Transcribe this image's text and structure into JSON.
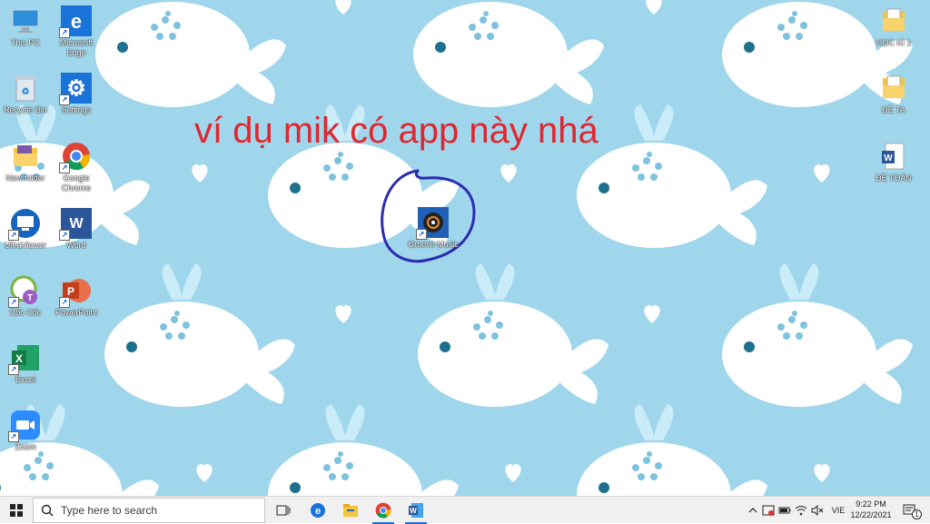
{
  "desktop": {
    "overlay_text": "ví dụ mik có app này nhá",
    "left_icons": [
      {
        "label": "This PC",
        "icon": "computer-icon"
      },
      {
        "label": "Microsoft Edge",
        "icon": "edge-icon"
      },
      {
        "label": "Recycle Bin",
        "icon": "recycle-bin-icon"
      },
      {
        "label": "Settings",
        "icon": "gear-icon"
      },
      {
        "label": "New folder",
        "icon": "folder-icon"
      },
      {
        "label": "Google Chrome",
        "icon": "chrome-icon"
      },
      {
        "label": "UltraViewer",
        "icon": "ultraviewer-icon"
      },
      {
        "label": "Word",
        "icon": "word-icon"
      },
      {
        "label": "Cốc Cốc",
        "icon": "coccoc-icon"
      },
      {
        "label": "PowerPoint",
        "icon": "powerpoint-icon"
      },
      {
        "label": "Excel",
        "icon": "excel-icon"
      },
      {
        "label": "Zoom",
        "icon": "zoom-icon"
      }
    ],
    "center_icon": {
      "label": "Groove Music",
      "icon": "groove-music-icon"
    },
    "right_icons": [
      {
        "label": "HỌC KÌ 1",
        "icon": "folder-icon"
      },
      {
        "label": "ĐỀ TA",
        "icon": "folder-icon"
      },
      {
        "label": "ĐỀ TOÁN",
        "icon": "word-document-icon"
      }
    ]
  },
  "taskbar": {
    "search_placeholder": "Type here to search",
    "pinned": [
      "task-view-icon",
      "edge-icon",
      "file-explorer-icon",
      "chrome-icon",
      "word-icon"
    ],
    "tray": {
      "language": "VIE",
      "time": "9:22 PM",
      "date": "12/22/2021",
      "notification_count": "1"
    }
  },
  "colors": {
    "wallpaper": "#9fd6ec",
    "overlay_text": "#e0262e",
    "circle": "#2b2bb0"
  }
}
